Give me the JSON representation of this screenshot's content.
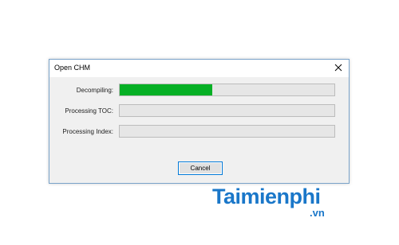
{
  "dialog": {
    "title": "Open CHM",
    "rows": [
      {
        "label": "Decompiling:",
        "progress": 0.43
      },
      {
        "label": "Processing TOC:",
        "progress": 0
      },
      {
        "label": "Processing Index:",
        "progress": 0
      }
    ],
    "cancel_label": "Cancel"
  },
  "watermark": {
    "main": "Taimienphi",
    "suffix": ".vn"
  },
  "colors": {
    "progress": "#06b025",
    "accent": "#0078d7",
    "brand": "#1a77c9"
  }
}
